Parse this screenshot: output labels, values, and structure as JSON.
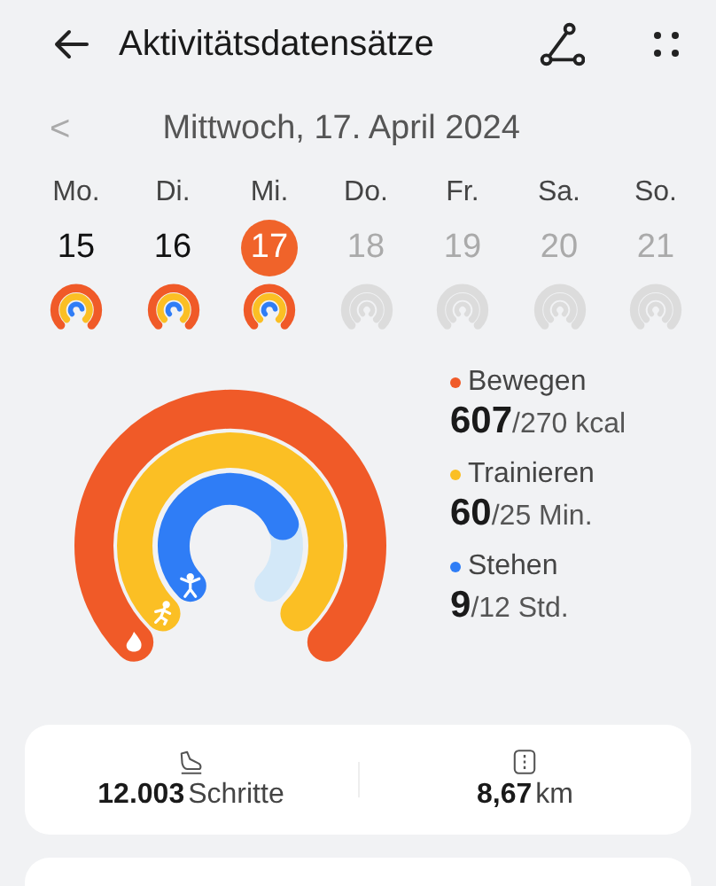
{
  "header": {
    "title": "Aktivitätsdatensätze"
  },
  "date_nav": {
    "prev": "<",
    "date": "Mittwoch, 17. April 2024"
  },
  "week": [
    {
      "day": "Mo.",
      "date": "15",
      "selected": false,
      "has_data": true
    },
    {
      "day": "Di.",
      "date": "16",
      "selected": false,
      "has_data": true
    },
    {
      "day": "Mi.",
      "date": "17",
      "selected": true,
      "has_data": true
    },
    {
      "day": "Do.",
      "date": "18",
      "selected": false,
      "has_data": false
    },
    {
      "day": "Fr.",
      "date": "19",
      "selected": false,
      "has_data": false
    },
    {
      "day": "Sa.",
      "date": "20",
      "selected": false,
      "has_data": false
    },
    {
      "day": "So.",
      "date": "21",
      "selected": false,
      "has_data": false
    }
  ],
  "metrics": [
    {
      "kind": "move",
      "label": "Bewegen",
      "value": "607",
      "goal": "/270 kcal",
      "color": "#f05a28"
    },
    {
      "kind": "exercise",
      "label": "Trainieren",
      "value": "60",
      "goal": "/25 Min.",
      "color": "#fbbf24"
    },
    {
      "kind": "stand",
      "label": "Stehen",
      "value": "9",
      "goal": "/12 Std.",
      "color": "#2f7df6"
    }
  ],
  "summary": [
    {
      "kind": "steps",
      "value": "12.003",
      "unit": "Schritte"
    },
    {
      "kind": "distance",
      "value": "8,67",
      "unit": "km"
    }
  ]
}
